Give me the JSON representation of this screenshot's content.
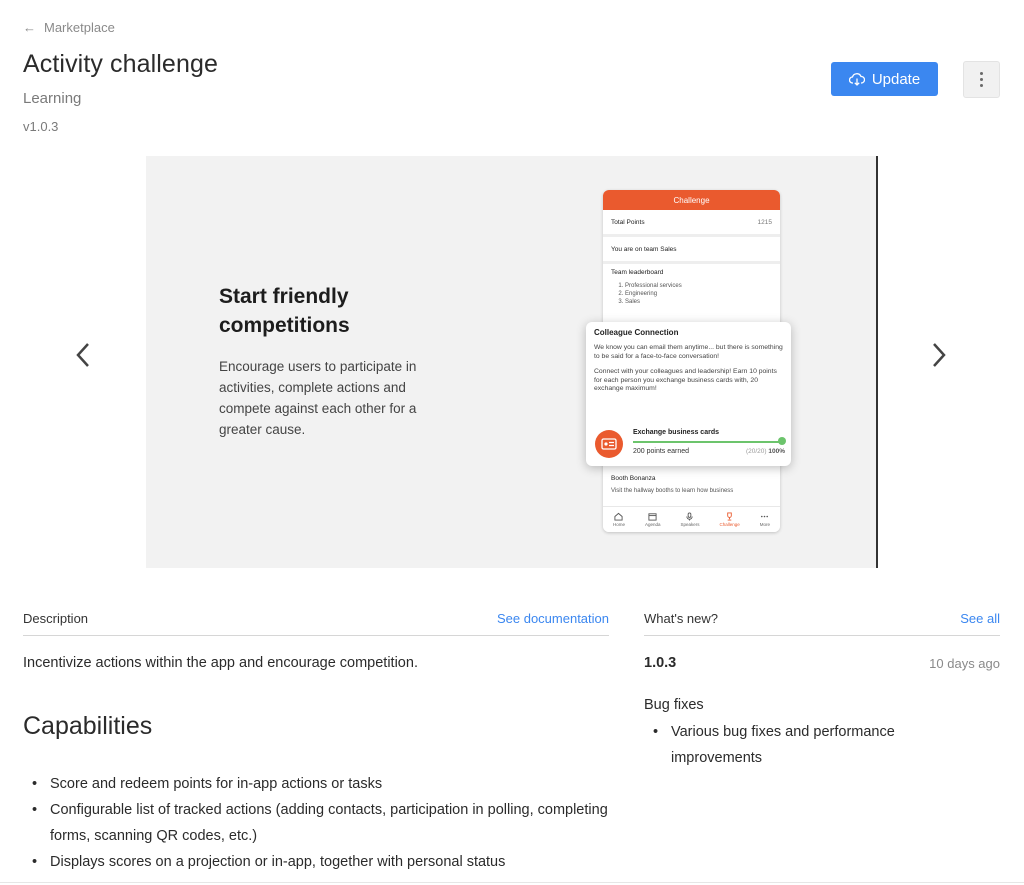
{
  "nav": {
    "back_label": "Marketplace"
  },
  "app": {
    "title": "Activity challenge",
    "category": "Learning",
    "version": "v1.0.3"
  },
  "actions": {
    "update_label": "Update"
  },
  "carousel": {
    "slide": {
      "heading": "Start friendly competitions",
      "text": "Encourage users to participate in activities, complete actions and compete against each other for a greater cause."
    },
    "phone": {
      "header": "Challenge",
      "total_points_label": "Total Points",
      "total_points_value": "1215",
      "team_text": "You are on team Sales",
      "leaderboard_title": "Team leaderboard",
      "leaderboard": [
        "Professional services",
        "Engineering",
        "Sales"
      ],
      "booth_title": "Booth Bonanza",
      "booth_text": "Visit the hallway booths to learn how business",
      "tabs": [
        "Home",
        "Agenda",
        "Speakers",
        "Challenge",
        "More"
      ]
    },
    "card": {
      "title": "Colleague Connection",
      "p1": "We know you can email them anytime... but there is something to be said for a face-to-face conversation!",
      "p2": "Connect with your colleagues and leadership! Earn 10 points for each person you exchange business cards with, 20 exchange maximum!",
      "activity": "Exchange business cards",
      "earned": "200 points earned",
      "count": "(20/20)",
      "percent": "100%",
      "progress": 1.0
    }
  },
  "description": {
    "header": "Description",
    "link": "See documentation",
    "text": "Incentivize actions within the app and encourage competition.",
    "capabilities_title": "Capabilities",
    "capabilities": [
      "Score and redeem points for in-app actions or tasks",
      "Configurable list of tracked actions (adding contacts, participation in polling, completing forms, scanning QR codes, etc.)",
      "Displays scores on a projection or in-app, together with personal status"
    ]
  },
  "whats_new": {
    "header": "What's new?",
    "link": "See all",
    "version": "1.0.3",
    "date": "10 days ago",
    "subtitle": "Bug fixes",
    "items": [
      "Various bug fixes and performance improvements"
    ]
  },
  "colors": {
    "accent": "#3b87f0",
    "brand_orange": "#ea5a2e",
    "success": "#6cc46c"
  }
}
